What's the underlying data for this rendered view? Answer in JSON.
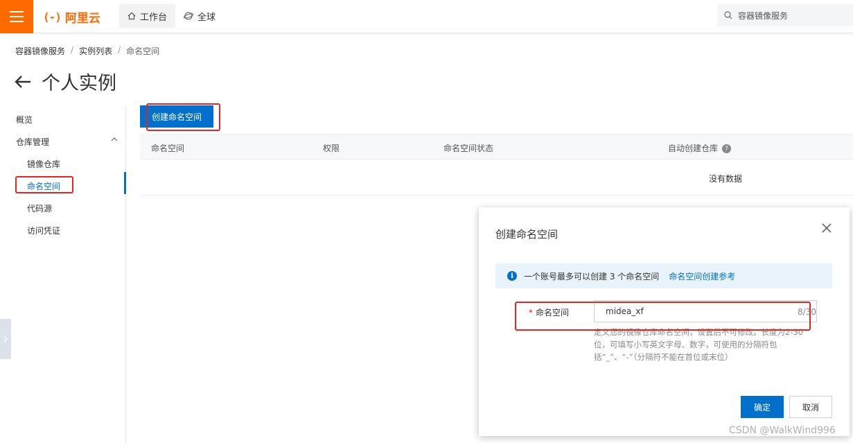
{
  "topbar": {
    "logo_text": "阿里云",
    "logo_mark": "(-)",
    "nav": [
      {
        "label": "工作台",
        "icon": "home-icon"
      },
      {
        "label": "全球",
        "icon": "globe-icon"
      }
    ],
    "search_placeholder": "容器镜像服务"
  },
  "breadcrumb": [
    "容器镜像服务",
    "实例列表",
    "命名空间"
  ],
  "page_title": "个人实例",
  "sidebar": {
    "items": [
      {
        "label": "概览"
      },
      {
        "label": "仓库管理"
      },
      {
        "label": "镜像仓库"
      },
      {
        "label": "命名空间"
      },
      {
        "label": "代码源"
      },
      {
        "label": "访问凭证"
      }
    ],
    "active": "命名空间"
  },
  "main": {
    "create_button": "创建命名空间",
    "columns": [
      "命名空间",
      "权限",
      "命名空间状态",
      "自动创建仓库"
    ],
    "empty_text": "没有数据"
  },
  "dialog": {
    "title": "创建命名空间",
    "notice_text": "一个账号最多可以创建 3 个命名空间",
    "notice_link": "命名空间创建参考",
    "field_label": "命名空间",
    "field_value": "midea_xf",
    "counter": "8/30",
    "help_text": "定义您的镜像仓库命名空间，设置后不可修改。长度为2-30位，可填写小写英文字母、数字，可使用的分隔符包括“_”、“-”（分隔符不能在首位或末位）",
    "ok_label": "确定",
    "cancel_label": "取消"
  },
  "watermark": "CSDN @WalkWind996",
  "colors": {
    "brand": "#ff6a00",
    "primary": "#0070cc",
    "highlight": "#e8231f"
  }
}
